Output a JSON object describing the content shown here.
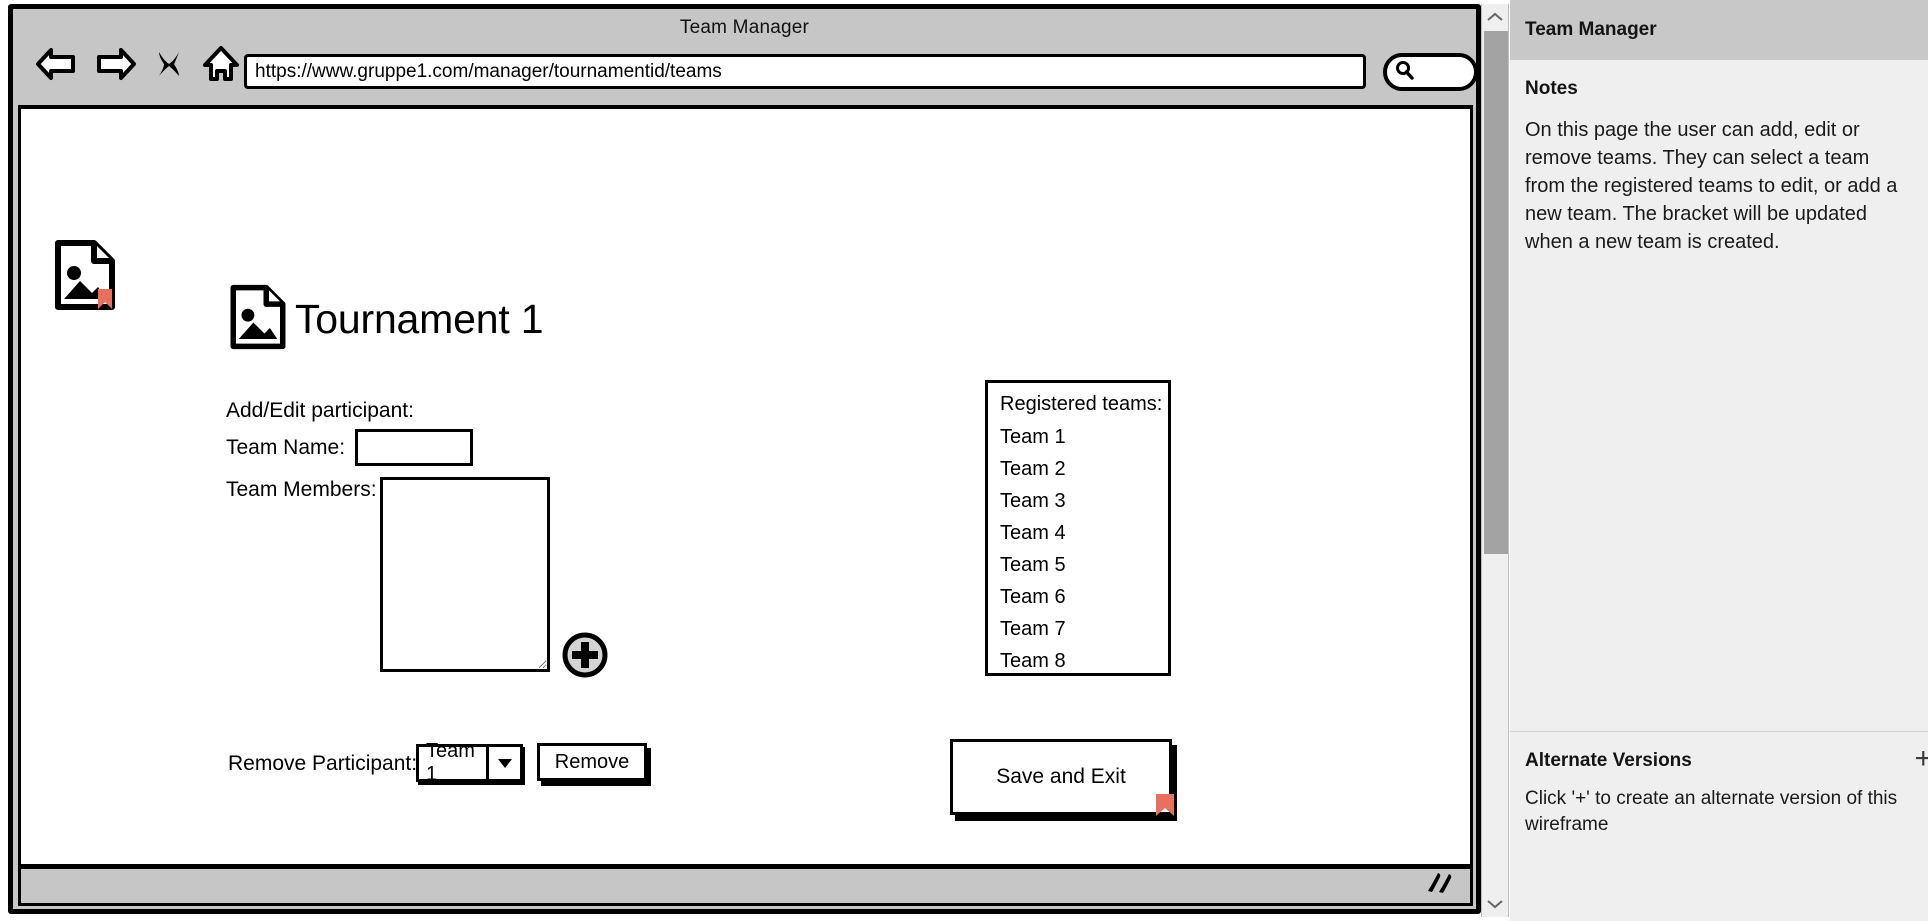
{
  "browser": {
    "window_title": "Team Manager",
    "url": "https://www.gruppe1.com/manager/tournamentid/teams",
    "nav": {
      "back": "back-arrow",
      "forward": "forward-arrow",
      "stop": "close-x",
      "home": "home"
    },
    "search_placeholder": ""
  },
  "page": {
    "title": "Tournament 1",
    "labels": {
      "add_edit": "Add/Edit participant:",
      "team_name": "Team Name:",
      "team_members": "Team Members:",
      "remove_participant": "Remove Participant:"
    },
    "inputs": {
      "team_name_value": "",
      "team_name_placeholder": "",
      "team_members_value": "",
      "team_members_placeholder": ""
    },
    "add_member_button": "+",
    "registered": {
      "header": "Registered teams:",
      "teams": [
        "Team 1",
        "Team 2",
        "Team 3",
        "Team 4",
        "Team 5",
        "Team 6",
        "Team 7",
        "Team 8"
      ]
    },
    "remove_select_value": "Team 1",
    "remove_button": "Remove",
    "save_button": "Save and Exit"
  },
  "sidebar": {
    "header": "Team Manager",
    "notes_title": "Notes",
    "notes_body": "On this page the user can add, edit or remove teams. They can select a team from the registered teams to edit, or add a new team. The bracket will be updated when a new team is created.",
    "alt_title": "Alternate Versions",
    "alt_body": "Click '+' to create an alternate version of this wireframe",
    "alt_add": "+"
  },
  "colors": {
    "chrome_gray": "#c6c6c6",
    "sidebar_header": "#c8c8c8",
    "sidebar_body": "#efefef",
    "link_marker": "#e8705f",
    "scroll_thumb": "#a3a3a3"
  }
}
